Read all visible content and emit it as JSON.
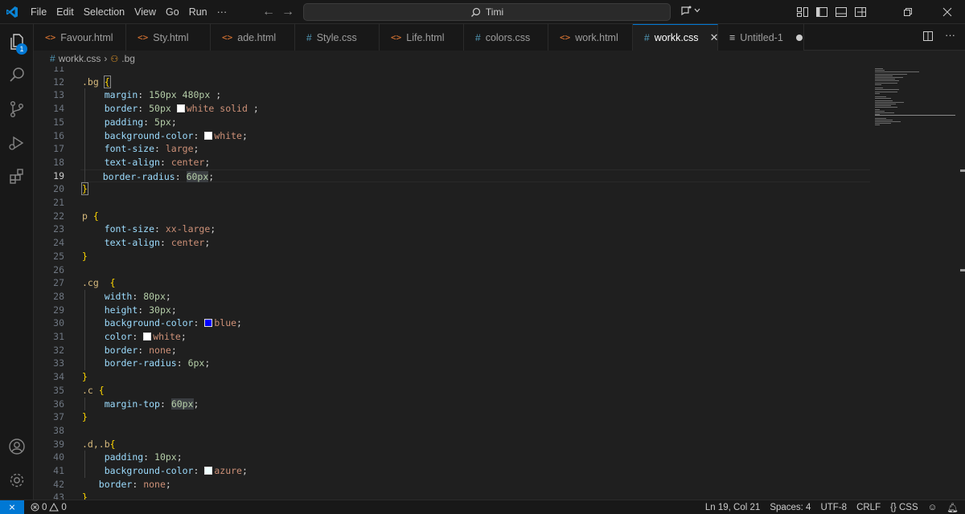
{
  "titlebar": {
    "menu": [
      "File",
      "Edit",
      "Selection",
      "View",
      "Go",
      "Run",
      "···"
    ],
    "search_text": "Timi"
  },
  "activity": {
    "explorer_badge": "1"
  },
  "tabs": [
    {
      "label": "Favour.html",
      "kind": "html"
    },
    {
      "label": "Sty.html",
      "kind": "html"
    },
    {
      "label": "ade.html",
      "kind": "html"
    },
    {
      "label": "Style.css",
      "kind": "css"
    },
    {
      "label": "Life.html",
      "kind": "html"
    },
    {
      "label": "colors.css",
      "kind": "css"
    },
    {
      "label": "work.html",
      "kind": "html"
    },
    {
      "label": "workk.css",
      "kind": "css",
      "active": true
    },
    {
      "label": "Untitled-1",
      "kind": "text",
      "dirty": true
    }
  ],
  "breadcrumb": {
    "file": "workk.css",
    "symbol": ".bg"
  },
  "editor": {
    "current_line": 19,
    "line_numbers": [
      "11",
      "12",
      "13",
      "14",
      "15",
      "16",
      "17",
      "18",
      "19",
      "20",
      "21",
      "22",
      "23",
      "24",
      "25",
      "26",
      "27",
      "28",
      "29",
      "30",
      "31",
      "32",
      "33",
      "34",
      "35",
      "36",
      "37",
      "38",
      "39",
      "40",
      "41",
      "42",
      "43"
    ]
  },
  "colors": {
    "accent": "#0078d4",
    "white_swatch": "#ffffff",
    "blue_swatch": "#0000ff",
    "azure_swatch": "#f0ffff"
  },
  "statusbar": {
    "errors": "0",
    "warnings": "0",
    "position": "Ln 19, Col 21",
    "spaces": "Spaces: 4",
    "encoding": "UTF-8",
    "eol": "CRLF",
    "language": "CSS"
  }
}
